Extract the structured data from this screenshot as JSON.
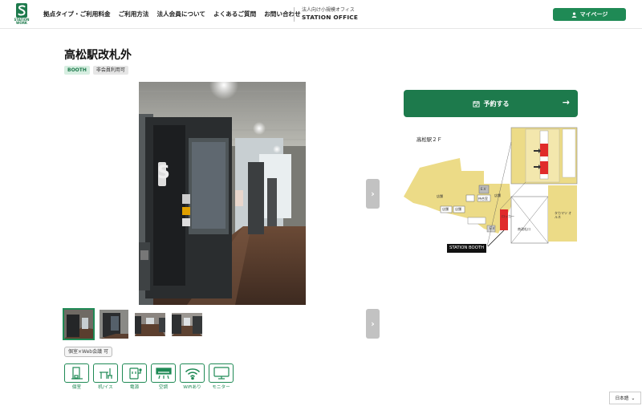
{
  "header": {
    "logo_text": "STATION WORK",
    "nav": [
      "拠点タイプ・ご利用料金",
      "ご利用方法",
      "法人会員について",
      "よくあるご質問",
      "お問い合わせ"
    ],
    "office_sub": "法人向け小規模オフィス",
    "office_main": "STATION OFFICE",
    "mypage_label": "マイページ"
  },
  "location": {
    "title": "高松駅改札外",
    "badges": [
      "BOOTH",
      "非会員利用可"
    ]
  },
  "photos": {
    "thumbnail_count": 4,
    "active_index": 0
  },
  "features": {
    "web_tag": "個室×Web会議 可",
    "amenities": [
      "個室",
      "机/イス",
      "電源",
      "空調",
      "WiFiあり",
      "モニター"
    ]
  },
  "reserve": {
    "label": "予約する"
  },
  "map": {
    "title": "高松駅２Ｆ",
    "labels": {
      "shop": "店舗",
      "ev": "E.V",
      "elevator": "E.V",
      "waiting": "待合室",
      "takamatsu": "タカマツ オルネ",
      "locker": "ロッカー",
      "entrance": "南改札口"
    },
    "booth_label": "STATION BOOTH"
  },
  "language": {
    "label": "日本語"
  },
  "colors": {
    "brand": "#1d7a4c",
    "accent": "#1f8a55",
    "map_floor": "#ecdb87",
    "map_booth": "#e02b2b"
  }
}
